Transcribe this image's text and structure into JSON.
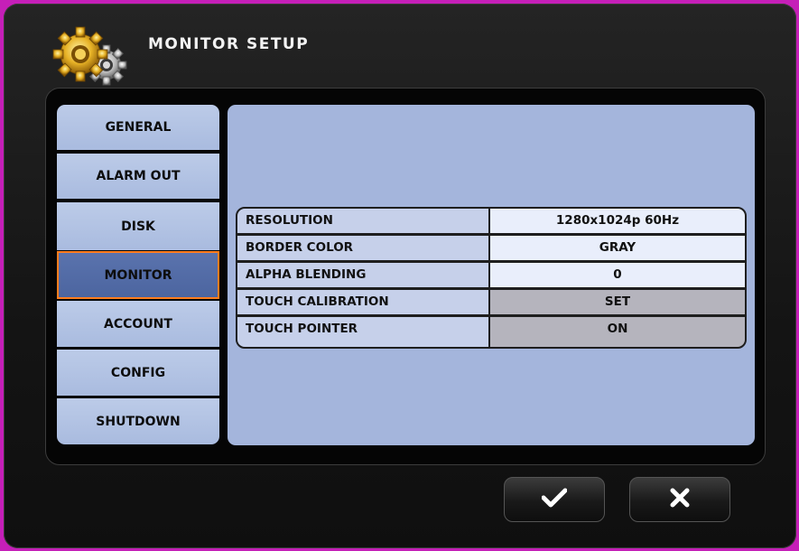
{
  "window": {
    "title": "MONITOR SETUP",
    "icon": "gears-icon"
  },
  "menu": [
    {
      "label": "GENERAL",
      "active": false
    },
    {
      "label": "ALARM OUT",
      "active": false
    },
    {
      "label": "DISK",
      "active": false
    },
    {
      "label": "MONITOR",
      "active": true
    },
    {
      "label": "ACCOUNT",
      "active": false
    },
    {
      "label": "CONFIG",
      "active": false
    },
    {
      "label": "SHUTDOWN",
      "active": false
    }
  ],
  "settings": [
    {
      "label": "RESOLUTION",
      "value": "1280x1024p 60Hz"
    },
    {
      "label": "BORDER COLOR",
      "value": "GRAY"
    },
    {
      "label": "ALPHA BLENDING",
      "value": "0"
    },
    {
      "label": "TOUCH CALIBRATION",
      "value": "SET"
    },
    {
      "label": "TOUCH POINTER",
      "value": "ON"
    }
  ],
  "buttons": {
    "ok_icon": "check-icon",
    "cancel_icon": "close-icon"
  },
  "colors": {
    "active_border": "#ff7d1e",
    "panel": "#a4b5dc",
    "menu": "#b4c5e6",
    "active_menu": "#526ba6"
  }
}
